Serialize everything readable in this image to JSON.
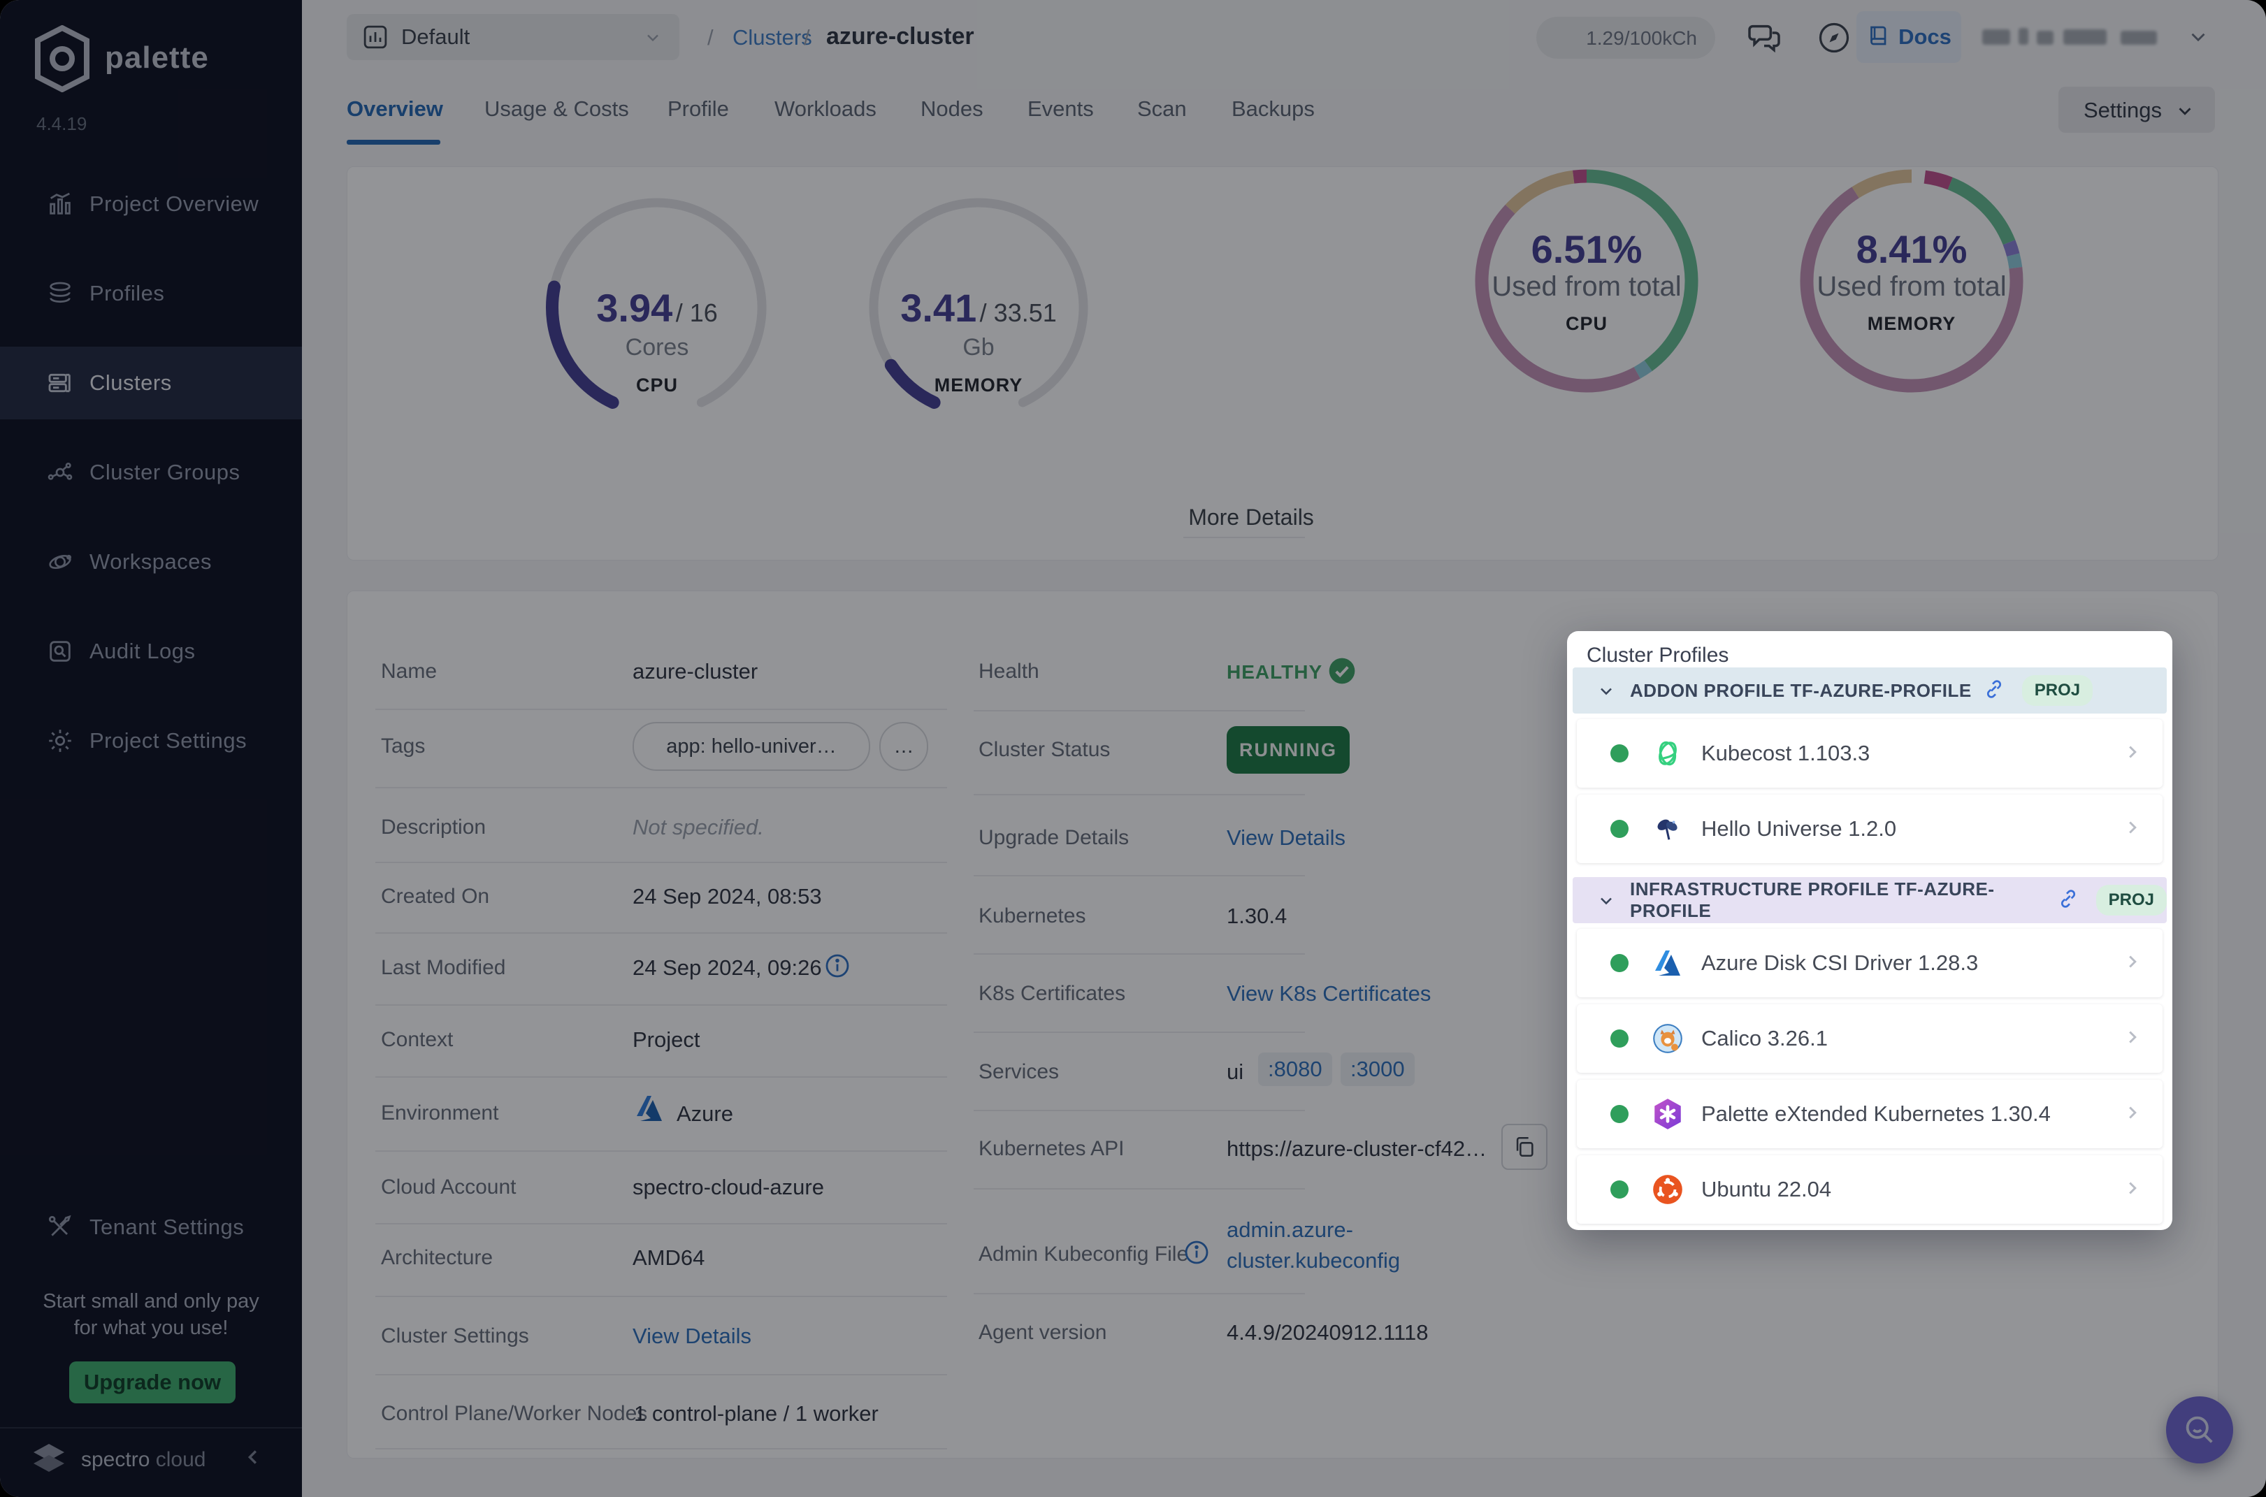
{
  "app": {
    "brand": "palette",
    "version": "4.4.19",
    "footer_brand_1": "spectro",
    "footer_brand_2": "cloud"
  },
  "sidebar": {
    "items": [
      {
        "label": "Project Overview"
      },
      {
        "label": "Profiles"
      },
      {
        "label": "Clusters"
      },
      {
        "label": "Cluster Groups"
      },
      {
        "label": "Workspaces"
      },
      {
        "label": "Audit Logs"
      },
      {
        "label": "Project Settings"
      }
    ],
    "tenant": {
      "label": "Tenant Settings"
    },
    "promo": {
      "line1": "Start small and only pay",
      "line2": "for what you use!",
      "cta": "Upgrade now"
    }
  },
  "topbar": {
    "project_selector": "Default",
    "breadcrumb": {
      "sep1": "/",
      "section": "Clusters",
      "sep2": "/",
      "page": "azure-cluster"
    },
    "usage": "1.29/100kCh",
    "docs_label": "Docs"
  },
  "tabs": {
    "items": [
      "Overview",
      "Usage & Costs",
      "Profile",
      "Workloads",
      "Nodes",
      "Events",
      "Scan",
      "Backups"
    ],
    "active": "Overview",
    "settings_label": "Settings"
  },
  "metrics": {
    "more_details": "More Details"
  },
  "chart_data": [
    {
      "id": "cpu-gauge",
      "type": "gauge",
      "value": 3.94,
      "max": 16,
      "value_label": "3.94",
      "max_label": "/ 16",
      "unit": "Cores",
      "caption": "CPU",
      "color": "#453f92",
      "track": "#e2e3e7",
      "arc_degrees": 310
    },
    {
      "id": "memory-gauge",
      "type": "gauge",
      "value": 3.41,
      "max": 33.51,
      "value_label": "3.41",
      "max_label": "/ 33.51",
      "unit": "Gb",
      "caption": "MEMORY",
      "color": "#453f92",
      "track": "#e2e3e7",
      "arc_degrees": 310
    },
    {
      "id": "cpu-donut",
      "type": "donut",
      "percent": 6.51,
      "percent_label": "6.51%",
      "subtitle": "Used from total",
      "caption": "CPU",
      "segments": [
        {
          "label": "green",
          "value": 40,
          "color": "#66bd92"
        },
        {
          "label": "blue",
          "value": 2,
          "color": "#8fcbdc"
        },
        {
          "label": "mauve",
          "value": 45,
          "color": "#c593b6"
        },
        {
          "label": "tan",
          "value": 11,
          "color": "#e2c69c"
        },
        {
          "label": "magenta",
          "value": 2,
          "color": "#c1518d"
        }
      ]
    },
    {
      "id": "memory-donut",
      "type": "donut",
      "percent": 8.41,
      "percent_label": "8.41%",
      "subtitle": "Used from total",
      "caption": "MEMORY",
      "segments": [
        {
          "label": "gap",
          "value": 2,
          "color": "#ffffff"
        },
        {
          "label": "magenta",
          "value": 4,
          "color": "#c1518d"
        },
        {
          "label": "green",
          "value": 13,
          "color": "#66bd92"
        },
        {
          "label": "purple",
          "value": 2,
          "color": "#8b80d6"
        },
        {
          "label": "blue",
          "value": 2,
          "color": "#8fcbdc"
        },
        {
          "label": "mauve",
          "value": 68,
          "color": "#c593b6"
        },
        {
          "label": "tan",
          "value": 9,
          "color": "#e2c69c"
        }
      ]
    }
  ],
  "details": {
    "name": {
      "label": "Name",
      "value": "azure-cluster"
    },
    "tags": {
      "label": "Tags",
      "tag1": "app: hello-univer…",
      "tag2": "…"
    },
    "description": {
      "label": "Description",
      "value": "Not specified."
    },
    "created": {
      "label": "Created On",
      "value": "24 Sep 2024, 08:53"
    },
    "modified": {
      "label": "Last Modified",
      "value": "24 Sep 2024, 09:26"
    },
    "context": {
      "label": "Context",
      "value": "Project"
    },
    "environment": {
      "label": "Environment",
      "value": "Azure"
    },
    "cloud_account": {
      "label": "Cloud Account",
      "value": "spectro-cloud-azure"
    },
    "architecture": {
      "label": "Architecture",
      "value": "AMD64"
    },
    "cluster_settings": {
      "label": "Cluster Settings",
      "link": "View Details"
    },
    "nodes": {
      "label": "Control Plane/Worker Nodes",
      "value": "1 control-plane / 1 worker"
    },
    "health": {
      "label": "Health",
      "value": "HEALTHY"
    },
    "status": {
      "label": "Cluster Status",
      "value": "RUNNING"
    },
    "upgrade": {
      "label": "Upgrade Details",
      "link": "View Details"
    },
    "kubernetes": {
      "label": "Kubernetes",
      "value": "1.30.4"
    },
    "certificates": {
      "label": "K8s Certificates",
      "link": "View K8s Certificates"
    },
    "services": {
      "label": "Services",
      "name": "ui",
      "port1": ":8080",
      "port2": ":3000"
    },
    "api": {
      "label": "Kubernetes API",
      "value": "https://azure-cluster-cf42…"
    },
    "kubeconfig": {
      "label": "Admin Kubeconfig File",
      "link_line1": "admin.azure-",
      "link_line2": "cluster.kubeconfig"
    },
    "agent": {
      "label": "Agent version",
      "value": "4.4.9/20240912.1118"
    }
  },
  "popup": {
    "title": "Cluster Profiles",
    "sections": [
      {
        "title": "ADDON PROFILE TF-AZURE-PROFILE",
        "badge": "PROJ",
        "items": [
          {
            "name": "Kubecost 1.103.3"
          },
          {
            "name": "Hello Universe 1.2.0"
          }
        ]
      },
      {
        "title": "INFRASTRUCTURE PROFILE TF-AZURE-PROFILE",
        "badge": "PROJ",
        "items": [
          {
            "name": "Azure Disk CSI Driver 1.28.3"
          },
          {
            "name": "Calico 3.26.1"
          },
          {
            "name": "Palette eXtended Kubernetes 1.30.4"
          },
          {
            "name": "Ubuntu 22.04"
          }
        ]
      }
    ]
  }
}
